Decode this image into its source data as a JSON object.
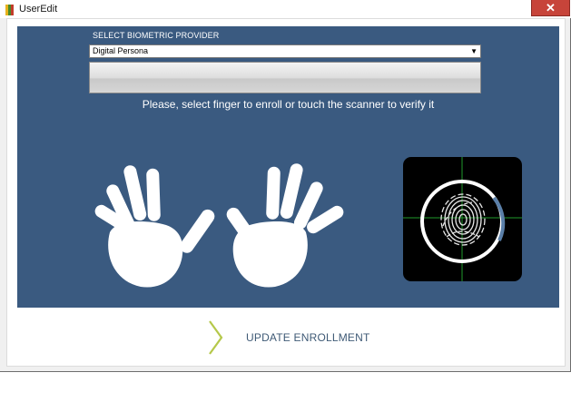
{
  "window": {
    "title": "UserEdit",
    "close_glyph": "✕"
  },
  "provider": {
    "label": "SELECT BIOMETRIC PROVIDER",
    "selected": "Digital Persona",
    "dropdown_icon": "triangle-down-icon"
  },
  "instruction": "Please, select finger to enroll or touch the scanner to verify it",
  "action": {
    "label": "UPDATE ENROLLMENT",
    "icon": "chevron-right-icon"
  },
  "colors": {
    "panel": "#3a5a80",
    "accent": "#b5c84a",
    "scanner_crosshair": "#1f9a2b",
    "close": "#c7443a"
  }
}
